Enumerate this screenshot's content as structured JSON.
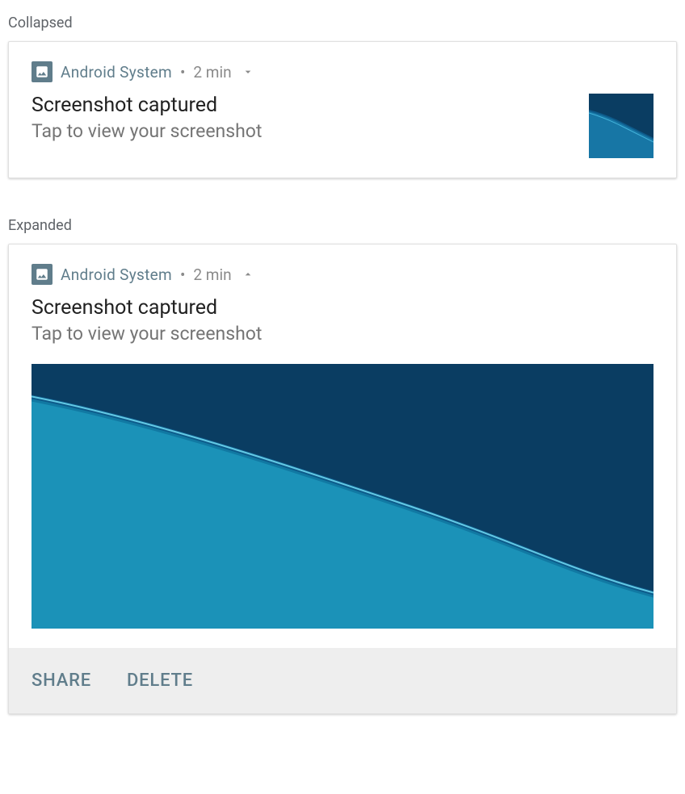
{
  "labels": {
    "collapsed": "Collapsed",
    "expanded": "Expanded"
  },
  "notification": {
    "app_name": "Android  System",
    "separator": "•",
    "timestamp": "2 min",
    "title": "Screenshot captured",
    "subtitle": "Tap to view your screenshot"
  },
  "actions": {
    "share": "SHARE",
    "delete": "DELETE"
  }
}
